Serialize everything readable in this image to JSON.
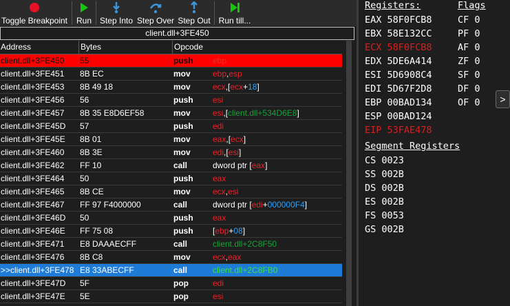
{
  "toolbar": {
    "toggle_breakpoint": "Toggle Breakpoint",
    "run": "Run",
    "step_into": "Step Into",
    "step_over": "Step Over",
    "step_out": "Step Out",
    "run_till": "Run till..."
  },
  "disassembler": {
    "title": "client.dll+3FE450",
    "columns": [
      "Address",
      "Bytes",
      "Opcode"
    ]
  },
  "rows": [
    {
      "addr": "client.dll+3FE450",
      "bytes": "55",
      "op": "push",
      "args": [
        [
          "reg",
          "ebp"
        ]
      ]
    },
    {
      "addr": "client.dll+3FE451",
      "bytes": "8B EC",
      "op": "mov",
      "args": [
        [
          "reg",
          "ebp"
        ],
        [
          "txt",
          ","
        ],
        [
          "reg",
          "esp"
        ]
      ]
    },
    {
      "addr": "client.dll+3FE453",
      "bytes": "8B 49 18",
      "op": "mov",
      "args": [
        [
          "reg",
          "ecx"
        ],
        [
          "txt",
          ","
        ],
        [
          "txt",
          "["
        ],
        [
          "reg",
          "ecx"
        ],
        [
          "txt",
          "+"
        ],
        [
          "num",
          "18"
        ],
        [
          "txt",
          "]"
        ]
      ]
    },
    {
      "addr": "client.dll+3FE456",
      "bytes": "56",
      "op": "push",
      "args": [
        [
          "reg",
          "esi"
        ]
      ]
    },
    {
      "addr": "client.dll+3FE457",
      "bytes": "8B 35 E8D6EF58",
      "op": "mov",
      "args": [
        [
          "reg",
          "esi"
        ],
        [
          "txt",
          ","
        ],
        [
          "txt",
          "["
        ],
        [
          "sym",
          "client.dll+534D6E8"
        ],
        [
          "txt",
          "]"
        ]
      ]
    },
    {
      "addr": "client.dll+3FE45D",
      "bytes": "57",
      "op": "push",
      "args": [
        [
          "reg",
          "edi"
        ]
      ]
    },
    {
      "addr": "client.dll+3FE45E",
      "bytes": "8B 01",
      "op": "mov",
      "args": [
        [
          "reg",
          "eax"
        ],
        [
          "txt",
          ","
        ],
        [
          "txt",
          "["
        ],
        [
          "reg",
          "ecx"
        ],
        [
          "txt",
          "]"
        ]
      ]
    },
    {
      "addr": "client.dll+3FE460",
      "bytes": "8B 3E",
      "op": "mov",
      "args": [
        [
          "reg",
          "edi"
        ],
        [
          "txt",
          ","
        ],
        [
          "txt",
          "["
        ],
        [
          "reg",
          "esi"
        ],
        [
          "txt",
          "]"
        ]
      ]
    },
    {
      "addr": "client.dll+3FE462",
      "bytes": "FF 10",
      "op": "call",
      "args": [
        [
          "txt",
          "dword ptr "
        ],
        [
          "txt",
          "["
        ],
        [
          "reg",
          "eax"
        ],
        [
          "txt",
          "]"
        ]
      ]
    },
    {
      "addr": "client.dll+3FE464",
      "bytes": "50",
      "op": "push",
      "args": [
        [
          "reg",
          "eax"
        ]
      ]
    },
    {
      "addr": "client.dll+3FE465",
      "bytes": "8B CE",
      "op": "mov",
      "args": [
        [
          "reg",
          "ecx"
        ],
        [
          "txt",
          ","
        ],
        [
          "reg",
          "esi"
        ]
      ]
    },
    {
      "addr": "client.dll+3FE467",
      "bytes": "FF 97 F4000000",
      "op": "call",
      "args": [
        [
          "txt",
          "dword ptr "
        ],
        [
          "txt",
          "["
        ],
        [
          "reg",
          "edi"
        ],
        [
          "txt",
          "+"
        ],
        [
          "num",
          "000000F4"
        ],
        [
          "txt",
          "]"
        ]
      ]
    },
    {
      "addr": "client.dll+3FE46D",
      "bytes": "50",
      "op": "push",
      "args": [
        [
          "reg",
          "eax"
        ]
      ]
    },
    {
      "addr": "client.dll+3FE46E",
      "bytes": "FF 75 08",
      "op": "push",
      "args": [
        [
          "txt",
          "["
        ],
        [
          "reg",
          "ebp"
        ],
        [
          "txt",
          "+"
        ],
        [
          "num",
          "08"
        ],
        [
          "txt",
          "]"
        ]
      ]
    },
    {
      "addr": "client.dll+3FE471",
      "bytes": "E8 DAAAECFF",
      "op": "call",
      "args": [
        [
          "sym",
          "client.dll+2C8F50"
        ]
      ]
    },
    {
      "addr": "client.dll+3FE476",
      "bytes": "8B C8",
      "op": "mov",
      "args": [
        [
          "reg",
          "ecx"
        ],
        [
          "txt",
          ","
        ],
        [
          "reg",
          "eax"
        ]
      ]
    },
    {
      "addr": ">>client.dll+3FE478",
      "bytes": "E8 33ABECFF",
      "op": "call",
      "args": [
        [
          "sym",
          "client.dll+2C8FB0"
        ]
      ]
    },
    {
      "addr": "client.dll+3FE47D",
      "bytes": "5F",
      "op": "pop",
      "args": [
        [
          "reg",
          "edi"
        ]
      ]
    },
    {
      "addr": "client.dll+3FE47E",
      "bytes": "5E",
      "op": "pop",
      "args": [
        [
          "reg",
          "esi"
        ]
      ]
    }
  ],
  "registers": {
    "title": "Registers:",
    "items": [
      {
        "text": "EAX 58F0FCB8",
        "changed": false
      },
      {
        "text": "EBX 58E132CC",
        "changed": false
      },
      {
        "text": "ECX 58F0FCB8",
        "changed": true
      },
      {
        "text": "EDX 5DE6A414",
        "changed": false
      },
      {
        "text": "ESI 5D6908C4",
        "changed": false
      },
      {
        "text": "EDI 5D67F2D8",
        "changed": false
      },
      {
        "text": "EBP 00BAD134",
        "changed": false
      },
      {
        "text": "ESP 00BAD124",
        "changed": false
      },
      {
        "text": "EIP 53FAE478",
        "changed": true
      }
    ]
  },
  "flags": {
    "title": "Flags",
    "items": [
      "CF 0",
      "PF 0",
      "AF 0",
      "ZF 0",
      "SF 0",
      "DF 0",
      "OF 0"
    ]
  },
  "segments": {
    "title": "Segment Registers",
    "items": [
      "CS 0023",
      "SS 002B",
      "DS 002B",
      "ES 002B",
      "FS 0053",
      "GS 002B"
    ]
  },
  "expand_label": ">"
}
